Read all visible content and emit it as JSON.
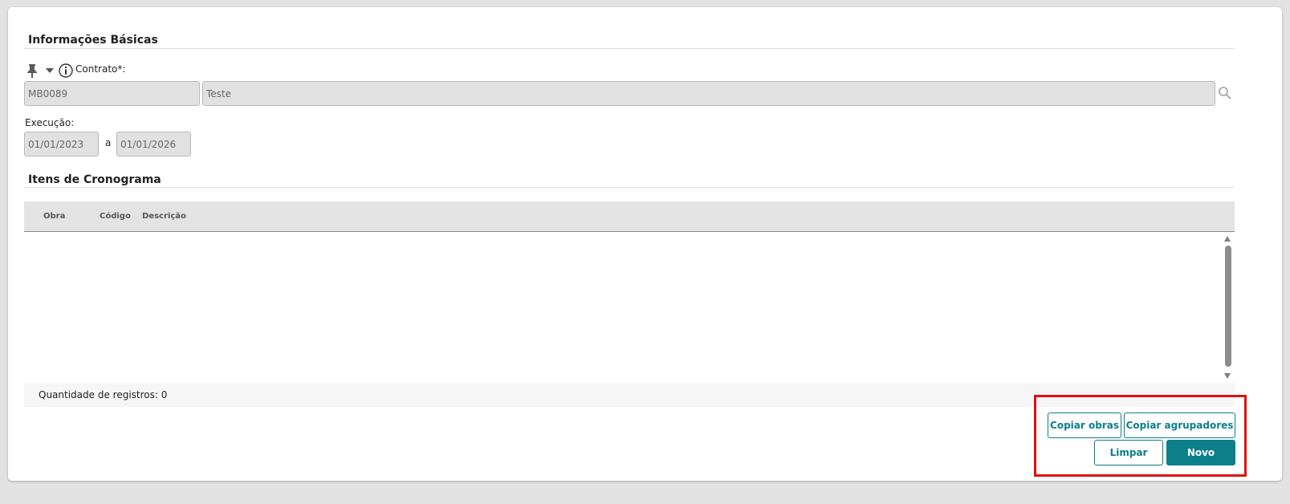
{
  "basic_info": {
    "title": "Informações Básicas",
    "contract_label": "Contrato*:",
    "contract_code": "MB0089",
    "contract_name": "Teste",
    "execution_label": "Execução:",
    "date_start": "01/01/2023",
    "date_separator": "a",
    "date_end": "01/01/2026"
  },
  "schedule": {
    "title": "Itens de Cronograma",
    "columns": [
      "Obra",
      "Código",
      "Descrição"
    ],
    "rows": [],
    "record_count_text": "Quantidade de registros: 0"
  },
  "actions": {
    "copy_works": "Copiar obras",
    "copy_groupers": "Copiar agrupadores",
    "clear": "Limpar",
    "new": "Novo"
  },
  "colors": {
    "accent": "#0b7f8a",
    "highlight": "#e01010",
    "field_bg": "#e1e1e1"
  },
  "icons": {
    "pin": "pin-icon",
    "dropdown": "caret-down-icon",
    "info": "info-icon",
    "search": "search-icon"
  }
}
